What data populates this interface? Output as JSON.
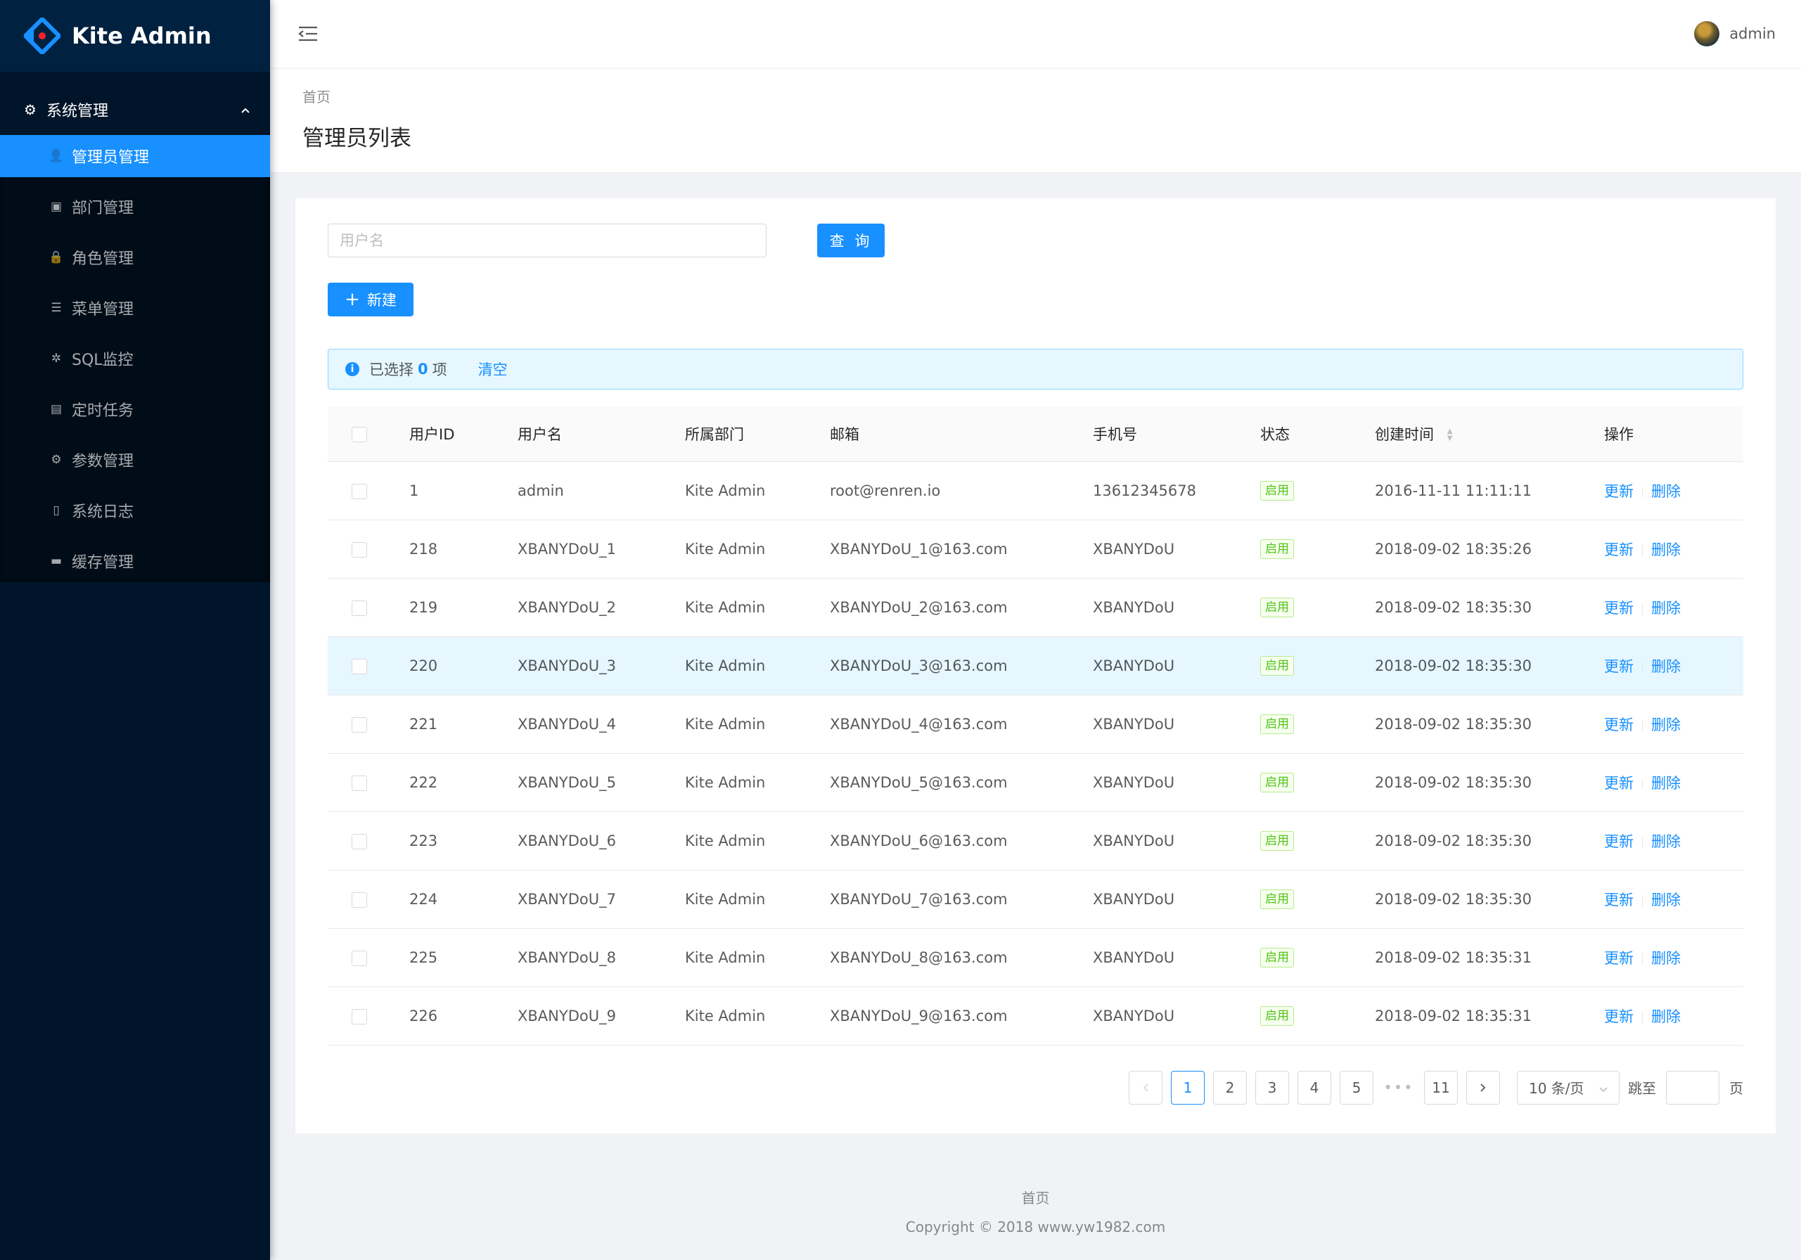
{
  "app": {
    "title": "Kite Admin"
  },
  "sidebar": {
    "group": {
      "label": "系统管理",
      "icon": "gear-icon",
      "expanded": true
    },
    "items": [
      {
        "label": "管理员管理",
        "icon": "user-icon",
        "active": true
      },
      {
        "label": "部门管理",
        "icon": "department-icon",
        "active": false
      },
      {
        "label": "角色管理",
        "icon": "lock-icon",
        "active": false
      },
      {
        "label": "菜单管理",
        "icon": "list-icon",
        "active": false
      },
      {
        "label": "SQL监控",
        "icon": "bug-icon",
        "active": false
      },
      {
        "label": "定时任务",
        "icon": "tasks-icon",
        "active": false
      },
      {
        "label": "参数管理",
        "icon": "cog-icon",
        "active": false
      },
      {
        "label": "系统日志",
        "icon": "file-icon",
        "active": false
      },
      {
        "label": "缓存管理",
        "icon": "archive-icon",
        "active": false
      }
    ]
  },
  "header": {
    "user_name": "admin"
  },
  "page": {
    "breadcrumb": "首页",
    "title": "管理员列表"
  },
  "search": {
    "placeholder": "用户名",
    "value": "",
    "query_label": "查 询"
  },
  "toolbar": {
    "new_label": "新建"
  },
  "alert": {
    "prefix": "已选择",
    "count": "0",
    "suffix": "项",
    "clear_label": "清空"
  },
  "table": {
    "columns": [
      "用户ID",
      "用户名",
      "所属部门",
      "邮箱",
      "手机号",
      "状态",
      "创建时间",
      "操作"
    ],
    "update_label": "更新",
    "delete_label": "删除",
    "rows": [
      {
        "id": "1",
        "username": "admin",
        "dept": "Kite Admin",
        "email": "root@renren.io",
        "mobile": "13612345678",
        "status": "启用",
        "created": "2016-11-11 11:11:11"
      },
      {
        "id": "218",
        "username": "XBANYDoU_1",
        "dept": "Kite Admin",
        "email": "XBANYDoU_1@163.com",
        "mobile": "XBANYDoU",
        "status": "启用",
        "created": "2018-09-02 18:35:26"
      },
      {
        "id": "219",
        "username": "XBANYDoU_2",
        "dept": "Kite Admin",
        "email": "XBANYDoU_2@163.com",
        "mobile": "XBANYDoU",
        "status": "启用",
        "created": "2018-09-02 18:35:30"
      },
      {
        "id": "220",
        "username": "XBANYDoU_3",
        "dept": "Kite Admin",
        "email": "XBANYDoU_3@163.com",
        "mobile": "XBANYDoU",
        "status": "启用",
        "created": "2018-09-02 18:35:30"
      },
      {
        "id": "221",
        "username": "XBANYDoU_4",
        "dept": "Kite Admin",
        "email": "XBANYDoU_4@163.com",
        "mobile": "XBANYDoU",
        "status": "启用",
        "created": "2018-09-02 18:35:30"
      },
      {
        "id": "222",
        "username": "XBANYDoU_5",
        "dept": "Kite Admin",
        "email": "XBANYDoU_5@163.com",
        "mobile": "XBANYDoU",
        "status": "启用",
        "created": "2018-09-02 18:35:30"
      },
      {
        "id": "223",
        "username": "XBANYDoU_6",
        "dept": "Kite Admin",
        "email": "XBANYDoU_6@163.com",
        "mobile": "XBANYDoU",
        "status": "启用",
        "created": "2018-09-02 18:35:30"
      },
      {
        "id": "224",
        "username": "XBANYDoU_7",
        "dept": "Kite Admin",
        "email": "XBANYDoU_7@163.com",
        "mobile": "XBANYDoU",
        "status": "启用",
        "created": "2018-09-02 18:35:30"
      },
      {
        "id": "225",
        "username": "XBANYDoU_8",
        "dept": "Kite Admin",
        "email": "XBANYDoU_8@163.com",
        "mobile": "XBANYDoU",
        "status": "启用",
        "created": "2018-09-02 18:35:31"
      },
      {
        "id": "226",
        "username": "XBANYDoU_9",
        "dept": "Kite Admin",
        "email": "XBANYDoU_9@163.com",
        "mobile": "XBANYDoU",
        "status": "启用",
        "created": "2018-09-02 18:35:31"
      }
    ]
  },
  "pagination": {
    "pages": [
      "1",
      "2",
      "3",
      "4",
      "5"
    ],
    "last_page": "11",
    "ellipsis": "•••",
    "current": "1",
    "page_size": "10 条/页",
    "jump_label": "跳至",
    "page_suffix": "页"
  },
  "footer": {
    "link": "首页",
    "copyright": "Copyright © 2018 www.yw1982.com"
  },
  "colors": {
    "primary": "#1890ff",
    "sider": "#001529",
    "success": "#52c41a"
  }
}
